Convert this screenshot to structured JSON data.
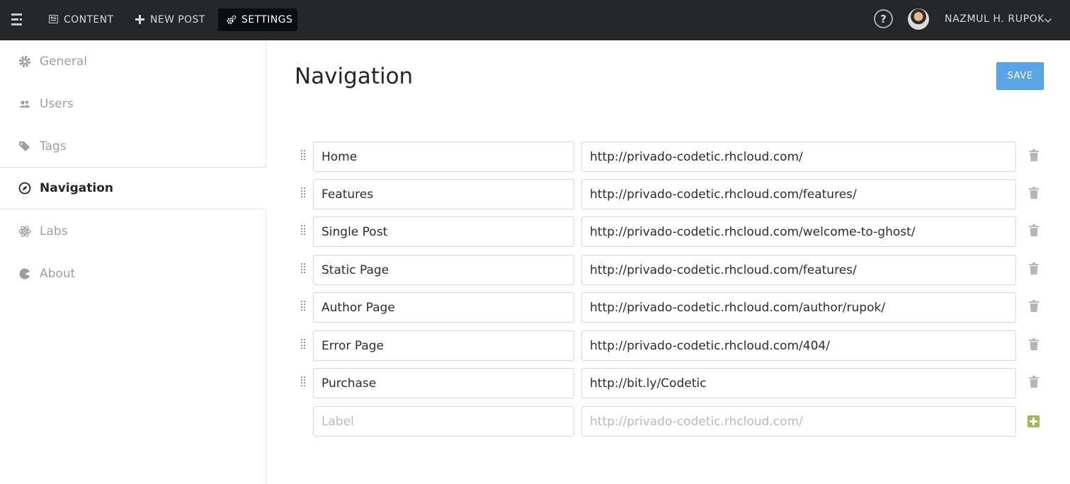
{
  "topbar": {
    "menu_icon": "menu-icon",
    "items": [
      {
        "label": "CONTENT",
        "icon": "content-icon"
      },
      {
        "label": "NEW POST",
        "icon": "plus-icon"
      },
      {
        "label": "SETTINGS",
        "icon": "gears-icon"
      }
    ],
    "help_label": "?",
    "user_name": "NAZMUL H. RUPOK"
  },
  "sidebar": {
    "items": [
      {
        "label": "General",
        "icon": "gear-icon"
      },
      {
        "label": "Users",
        "icon": "users-icon"
      },
      {
        "label": "Tags",
        "icon": "tag-icon"
      },
      {
        "label": "Navigation",
        "icon": "compass-icon"
      },
      {
        "label": "Labs",
        "icon": "atom-icon"
      },
      {
        "label": "About",
        "icon": "pie-icon"
      }
    ],
    "active": "Navigation"
  },
  "main": {
    "title": "Navigation",
    "save_label": "SAVE",
    "rows": [
      {
        "label": "Home",
        "url": "http://privado-codetic.rhcloud.com/"
      },
      {
        "label": "Features",
        "url": "http://privado-codetic.rhcloud.com/features/"
      },
      {
        "label": "Single Post",
        "url": "http://privado-codetic.rhcloud.com/welcome-to-ghost/"
      },
      {
        "label": "Static Page",
        "url": "http://privado-codetic.rhcloud.com/features/"
      },
      {
        "label": "Author Page",
        "url": "http://privado-codetic.rhcloud.com/author/rupok/"
      },
      {
        "label": "Error Page",
        "url": "http://privado-codetic.rhcloud.com/404/"
      },
      {
        "label": "Purchase",
        "url": "http://bit.ly/Codetic"
      }
    ],
    "new_row": {
      "label_placeholder": "Label",
      "url_placeholder": "http://privado-codetic.rhcloud.com/"
    }
  },
  "colors": {
    "topbar": "#242628",
    "accent": "#5ba4e5",
    "add": "#9fbb58"
  }
}
